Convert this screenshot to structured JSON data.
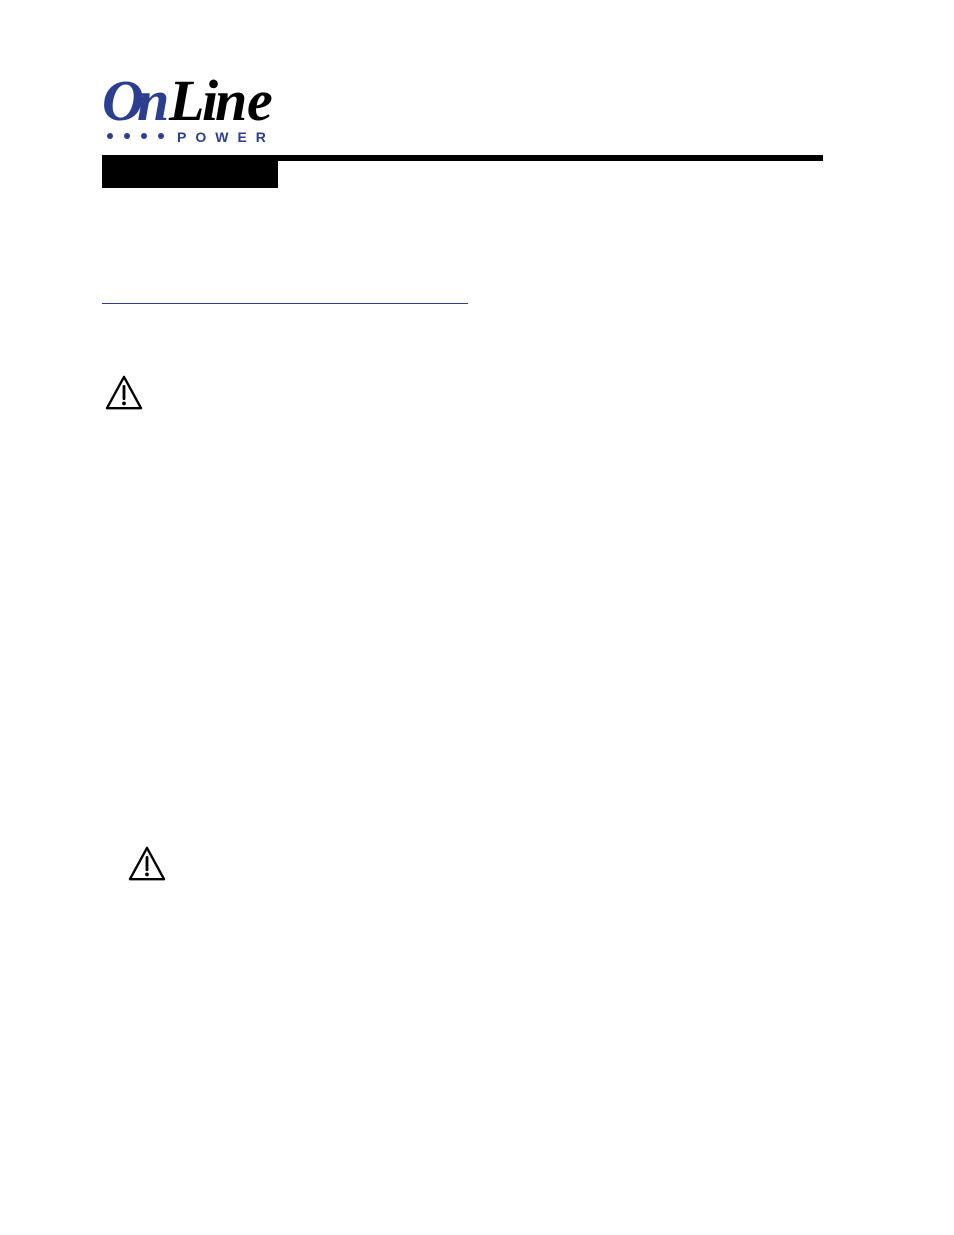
{
  "logo": {
    "main_text": "OnLine",
    "sub_text": "P O W E R"
  },
  "icons": {
    "warning_1": "warning-triangle-icon",
    "warning_2": "warning-triangle-icon"
  }
}
